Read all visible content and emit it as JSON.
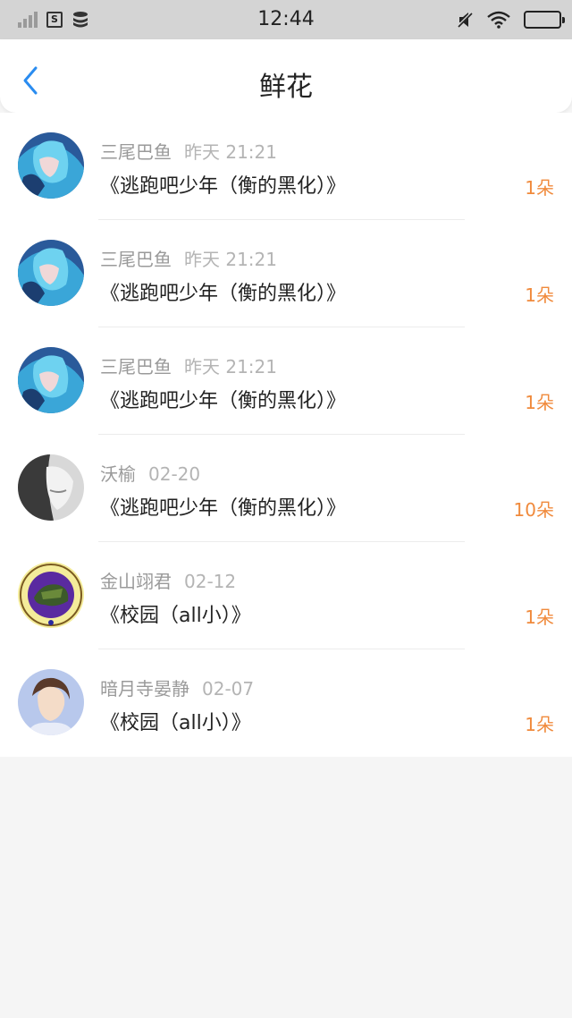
{
  "status_bar": {
    "time": "12:44",
    "icons": [
      "signal-icon",
      "sim-s-icon",
      "data-stack-icon",
      "mute-icon",
      "wifi-icon",
      "battery-icon"
    ]
  },
  "nav": {
    "title": "鲜花",
    "back_icon": "chevron-left-icon",
    "accent": "#2a8cf0"
  },
  "colors": {
    "count": "#f08a3c"
  },
  "items": [
    {
      "user": "三尾巴鱼",
      "time": "昨天 21:21",
      "title": "《逃跑吧少年（衡的黑化）》",
      "count": "1朵",
      "avatar": "anime-blue"
    },
    {
      "user": "三尾巴鱼",
      "time": "昨天 21:21",
      "title": "《逃跑吧少年（衡的黑化）》",
      "count": "1朵",
      "avatar": "anime-blue"
    },
    {
      "user": "三尾巴鱼",
      "time": "昨天 21:21",
      "title": "《逃跑吧少年（衡的黑化）》",
      "count": "1朵",
      "avatar": "anime-blue"
    },
    {
      "user": "沃榆",
      "time": "02-20",
      "title": "《逃跑吧少年（衡的黑化）》",
      "count": "10朵",
      "avatar": "grey-photo"
    },
    {
      "user": "金山翊君",
      "time": "02-12",
      "title": "《校园（all小）》",
      "count": "1朵",
      "avatar": "yellow-badge"
    },
    {
      "user": "暗月寺晏静",
      "time": "02-07",
      "title": "《校园（all小）》",
      "count": "1朵",
      "avatar": "portrait-light"
    }
  ]
}
